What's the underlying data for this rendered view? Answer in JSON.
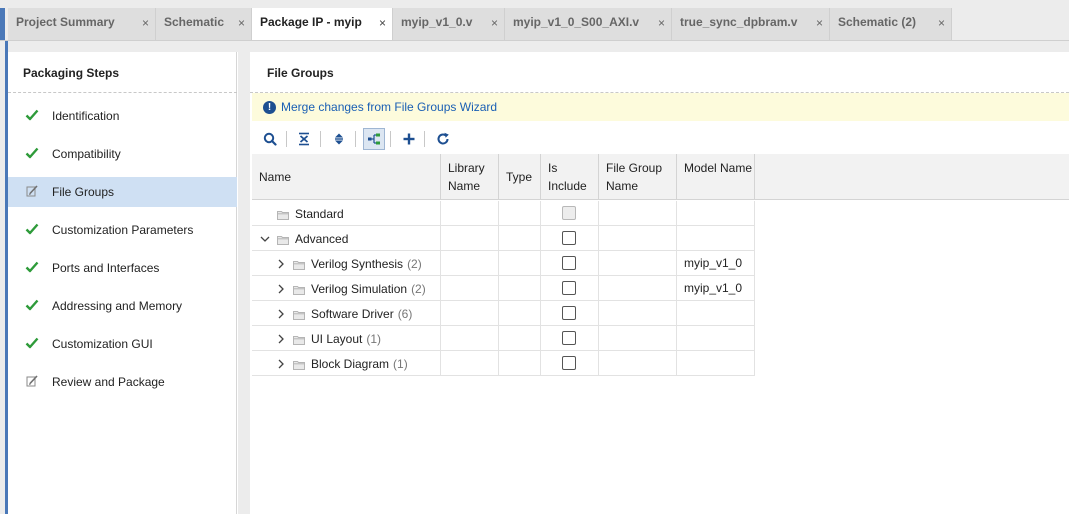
{
  "tabs": [
    {
      "label": "Project Summary",
      "active": false
    },
    {
      "label": "Schematic",
      "active": false
    },
    {
      "label": "Package IP - myip",
      "active": true
    },
    {
      "label": "myip_v1_0.v",
      "active": false
    },
    {
      "label": "myip_v1_0_S00_AXI.v",
      "active": false
    },
    {
      "label": "true_sync_dpbram.v",
      "active": false
    },
    {
      "label": "Schematic (2)",
      "active": false
    }
  ],
  "close_glyph": "×",
  "left_panel": {
    "title": "Packaging Steps",
    "steps": [
      {
        "label": "Identification",
        "icon": "check-icon",
        "selected": false
      },
      {
        "label": "Compatibility",
        "icon": "check-icon",
        "selected": false
      },
      {
        "label": "File Groups",
        "icon": "edit-icon",
        "selected": true
      },
      {
        "label": "Customization Parameters",
        "icon": "check-icon",
        "selected": false
      },
      {
        "label": "Ports and Interfaces",
        "icon": "check-icon",
        "selected": false
      },
      {
        "label": "Addressing and Memory",
        "icon": "check-icon",
        "selected": false
      },
      {
        "label": "Customization GUI",
        "icon": "check-icon",
        "selected": false
      },
      {
        "label": "Review and Package",
        "icon": "edit-icon",
        "selected": false
      }
    ]
  },
  "main": {
    "title": "File Groups",
    "banner": {
      "icon": "info-icon",
      "icon_glyph": "!",
      "text": "Merge changes from File Groups Wizard"
    },
    "toolbar": [
      {
        "name": "search-icon",
        "active": false
      },
      {
        "name": "collapse-all-icon",
        "active": false
      },
      {
        "name": "expand-all-icon",
        "active": false
      },
      {
        "name": "hierarchy-icon",
        "active": true
      },
      {
        "name": "add-icon",
        "active": false
      },
      {
        "name": "refresh-icon",
        "active": false
      }
    ],
    "columns": [
      {
        "label": "Name"
      },
      {
        "label": "Library Name"
      },
      {
        "label": "Type"
      },
      {
        "label": "Is Include"
      },
      {
        "label": "File Group Name"
      },
      {
        "label": "Model Name"
      }
    ],
    "rows": [
      {
        "name": "Standard",
        "count": "",
        "indent": 0,
        "chevron": "none",
        "include_disabled": true,
        "model": ""
      },
      {
        "name": "Advanced",
        "count": "",
        "indent": 0,
        "chevron": "down",
        "include_disabled": false,
        "model": ""
      },
      {
        "name": "Verilog Synthesis",
        "count": "(2)",
        "indent": 1,
        "chevron": "right",
        "include_disabled": false,
        "model": "myip_v1_0"
      },
      {
        "name": "Verilog Simulation",
        "count": "(2)",
        "indent": 1,
        "chevron": "right",
        "include_disabled": false,
        "model": "myip_v1_0"
      },
      {
        "name": "Software Driver",
        "count": "(6)",
        "indent": 1,
        "chevron": "right",
        "include_disabled": false,
        "model": ""
      },
      {
        "name": "UI Layout",
        "count": "(1)",
        "indent": 1,
        "chevron": "right",
        "include_disabled": false,
        "model": ""
      },
      {
        "name": "Block Diagram",
        "count": "(1)",
        "indent": 1,
        "chevron": "right",
        "include_disabled": false,
        "model": ""
      }
    ]
  },
  "colors": {
    "accent": "#4a78b8",
    "check": "#2e9b3a",
    "link": "#1a5fb4",
    "selected": "#cfe0f3",
    "banner": "#fdfbdc"
  }
}
